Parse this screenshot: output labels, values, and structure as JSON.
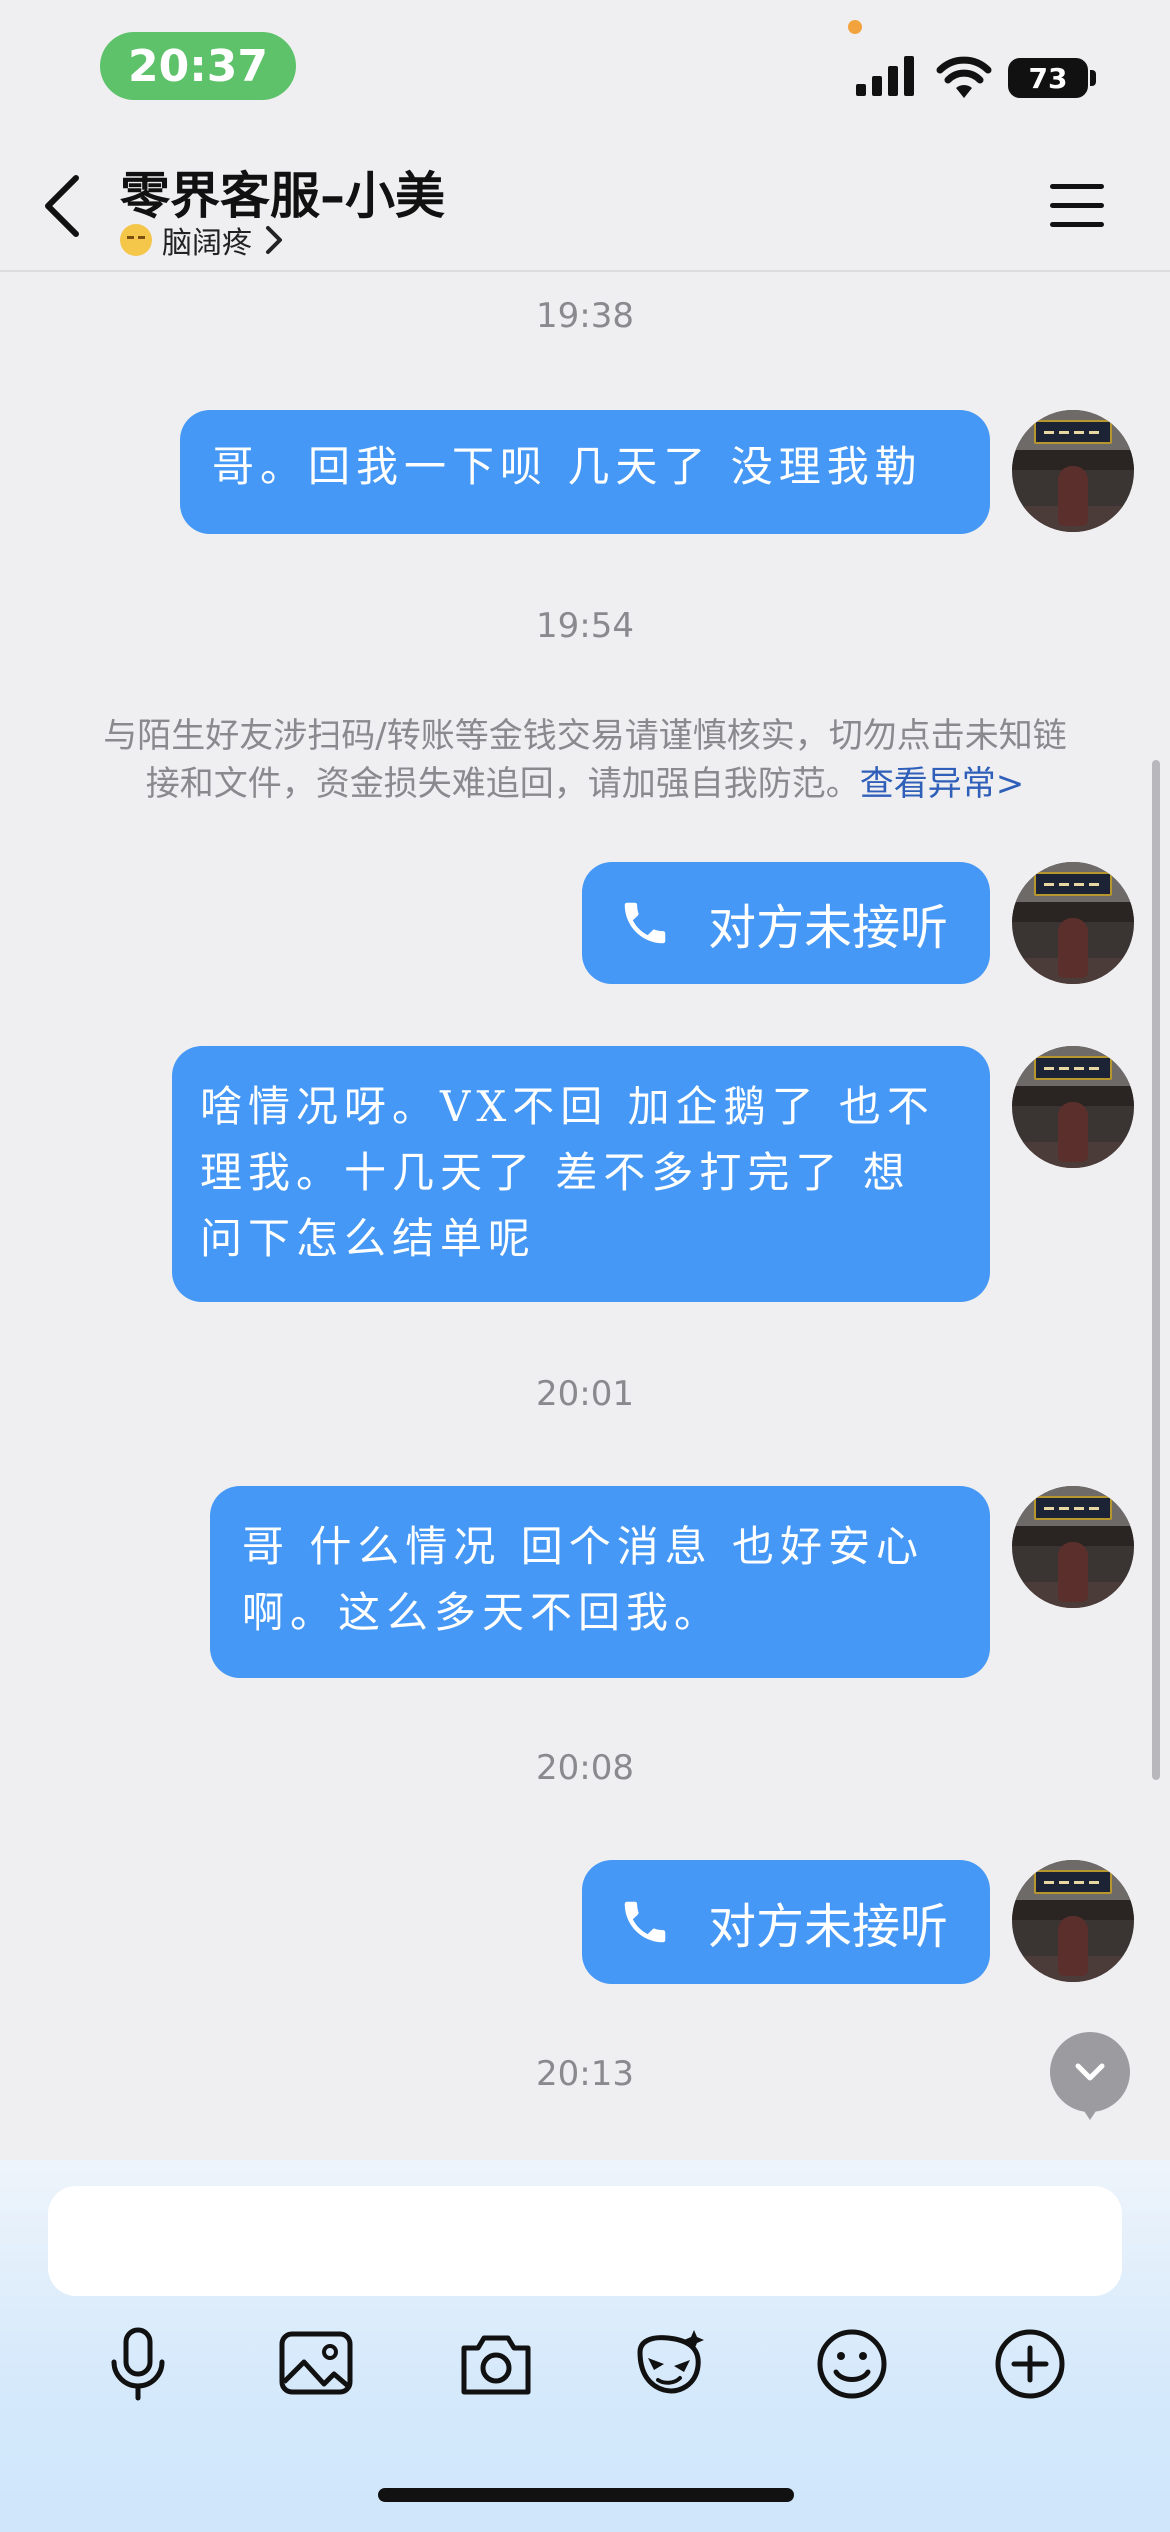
{
  "status_bar": {
    "time": "20:37",
    "battery": "73"
  },
  "header": {
    "title": "零界客服–小美",
    "status_text": "脑阔疼"
  },
  "messages": {
    "t1": "19:38",
    "m1": "哥。回我一下呗 几天了 没理我勒",
    "t2": "19:54",
    "warning": {
      "line1": "与陌生好友涉扫码/转账等金钱交易请谨慎核实，切勿点击未知链",
      "line2": "接和文件，资金损失难追回，请加强自我防范。",
      "link": "查看异常>"
    },
    "call1": "对方未接听",
    "m2_line1": "啥情况呀。VX不回 加企鹅了 也不",
    "m2_line2": "理我。十几天了 差不多打完了 想",
    "m2_line3": "问下怎么结单呢",
    "t3": "20:01",
    "m3_line1": "哥 什么情况 回个消息 也好安心",
    "m3_line2": "啊。这么多天不回我。",
    "t4": "20:08",
    "call2": "对方未接听",
    "t5": "20:13"
  },
  "input": {
    "placeholder": ""
  },
  "icons": {
    "back": "chevron-left-icon",
    "menu": "hamburger-menu-icon",
    "call": "phone-icon",
    "scroll_down": "chevron-down-icon",
    "tools": [
      "microphone-icon",
      "image-icon",
      "camera-icon",
      "sticker-icon",
      "emoji-icon",
      "plus-icon"
    ]
  },
  "colors": {
    "bubble": "#4598f5",
    "time_pill": "#5ec26a",
    "link": "#2f5fb8"
  }
}
